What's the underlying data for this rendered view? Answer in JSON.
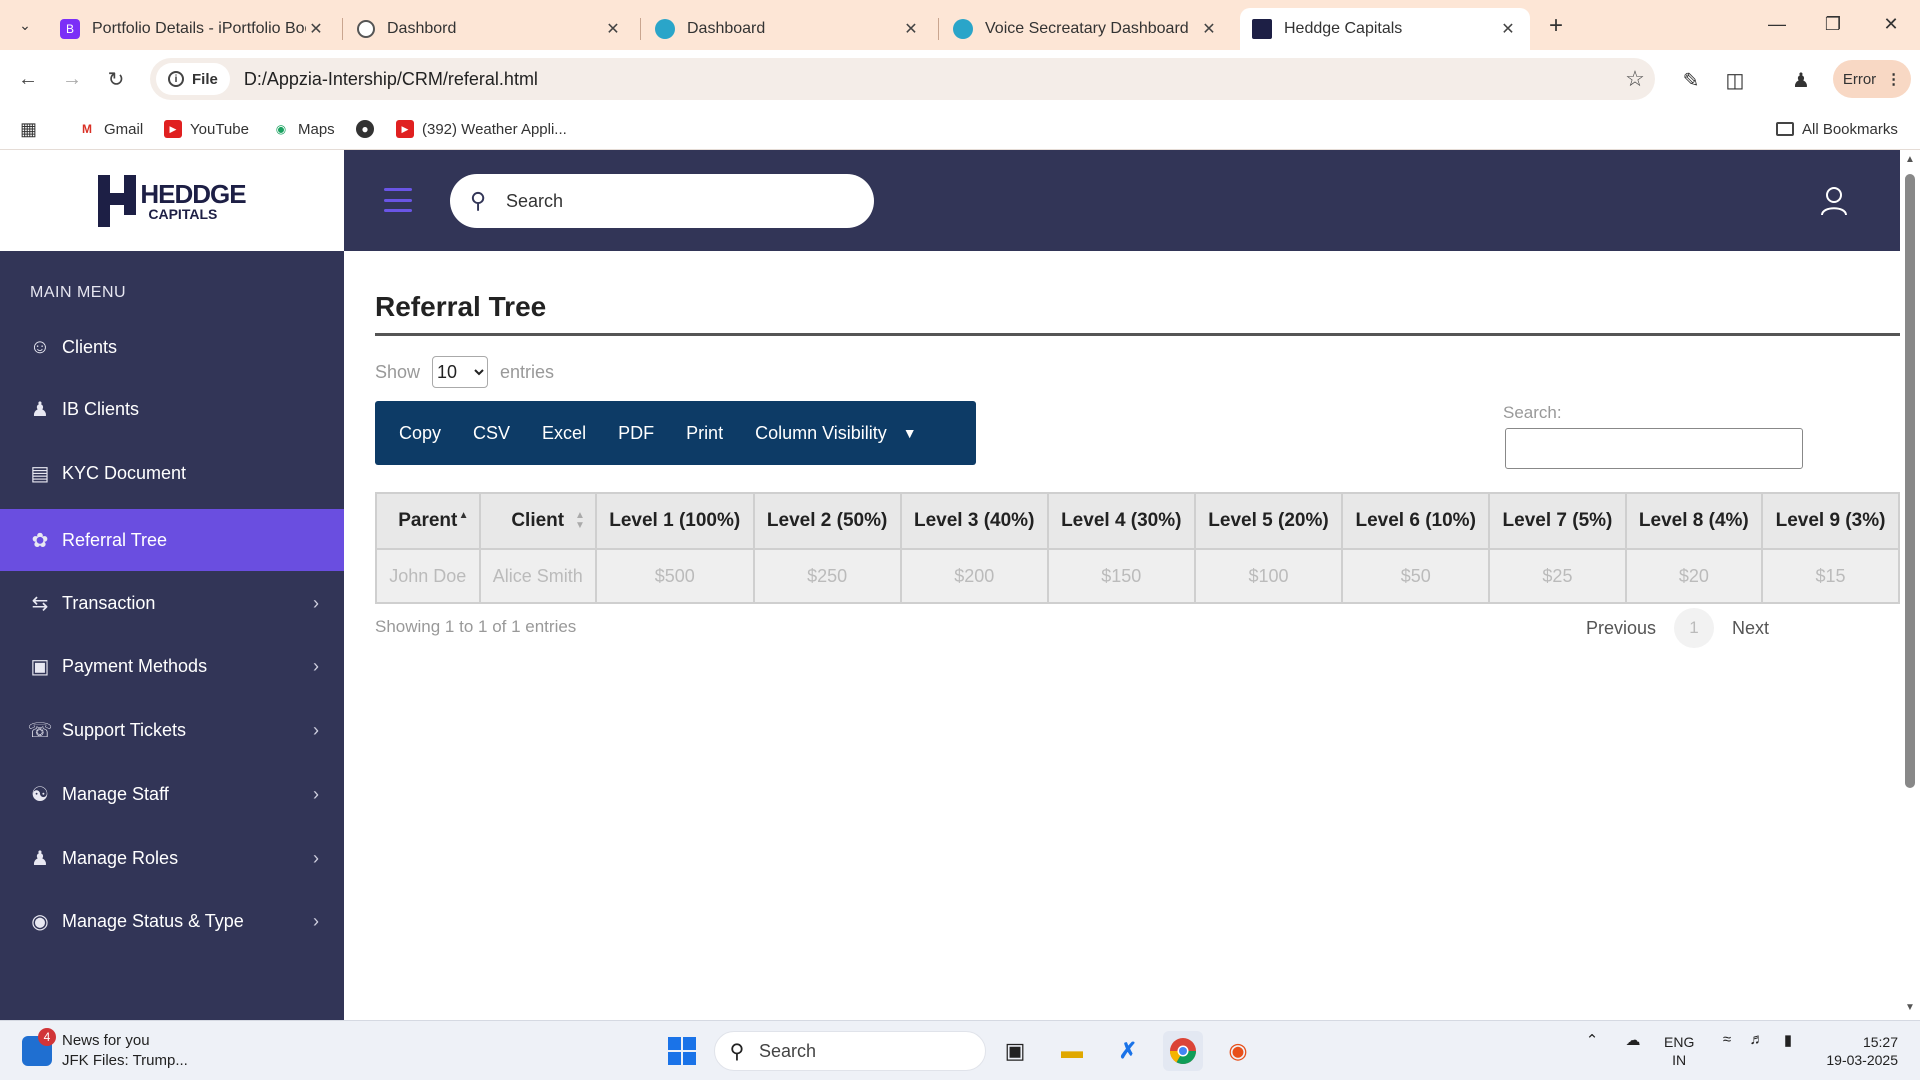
{
  "browser": {
    "tabs": [
      {
        "title": "Portfolio Details - iPortfolio Boo",
        "favicon_letter": "B",
        "favicon_color": "#7b2ff7"
      },
      {
        "title": "Dashbord",
        "favicon_letter": "",
        "favicon_color": "#555555"
      },
      {
        "title": "Dashboard",
        "favicon_letter": "",
        "favicon_color": "#2aa5c9"
      },
      {
        "title": "Voice Secreatary Dashboard",
        "favicon_letter": "",
        "favicon_color": "#2aa5c9"
      },
      {
        "title": "Heddge Capitals",
        "favicon_letter": "",
        "favicon_color": "#1d1f45"
      }
    ],
    "address": {
      "chip_label": "File",
      "url": "D:/Appzia-Intership/CRM/referal.html"
    },
    "profile_button": "Error",
    "bookmarks": [
      {
        "label": "Gmail",
        "icon": "gmail-icon"
      },
      {
        "label": "YouTube",
        "icon": "youtube-icon"
      },
      {
        "label": "Maps",
        "icon": "maps-icon"
      },
      {
        "label": "",
        "icon": "globe-icon"
      },
      {
        "label": "(392) Weather Appli...",
        "icon": "youtube-icon"
      }
    ],
    "all_bookmarks": "All Bookmarks"
  },
  "app": {
    "logo": {
      "line1": "HEDDGE",
      "line2": "CAPITALS"
    },
    "menu_heading": "MAIN MENU",
    "menu": [
      {
        "label": "Clients",
        "icon": "user-icon",
        "chevron": false,
        "active": false
      },
      {
        "label": "IB Clients",
        "icon": "ib-client-icon",
        "chevron": false,
        "active": false
      },
      {
        "label": "KYC Document",
        "icon": "document-icon",
        "chevron": false,
        "active": false
      },
      {
        "label": "Referral Tree",
        "icon": "referral-icon",
        "chevron": false,
        "active": true
      },
      {
        "label": "Transaction",
        "icon": "transaction-icon",
        "chevron": true,
        "active": false
      },
      {
        "label": "Payment Methods",
        "icon": "payment-icon",
        "chevron": true,
        "active": false
      },
      {
        "label": "Support Tickets",
        "icon": "support-icon",
        "chevron": true,
        "active": false
      },
      {
        "label": "Manage Staff",
        "icon": "staff-icon",
        "chevron": true,
        "active": false
      },
      {
        "label": "Manage Roles",
        "icon": "roles-icon",
        "chevron": true,
        "active": false
      },
      {
        "label": "Manage Status & Type",
        "icon": "status-icon",
        "chevron": true,
        "active": false
      }
    ],
    "search_placeholder": "Search",
    "colors": {
      "sidebar": "#323557",
      "active": "#6a4ee0",
      "button_group": "#0d3b66"
    }
  },
  "content": {
    "title": "Referral Tree",
    "show_label": "Show",
    "entries_label": "entries",
    "page_length": "10",
    "buttons": [
      "Copy",
      "CSV",
      "Excel",
      "PDF",
      "Print",
      "Column Visibility"
    ],
    "search_label": "Search:",
    "table": {
      "headers": [
        "Parent",
        "Client",
        "Level 1 (100%)",
        "Level 2 (50%)",
        "Level 3 (40%)",
        "Level 4 (30%)",
        "Level 5 (20%)",
        "Level 6 (10%)",
        "Level 7 (5%)",
        "Level 8 (4%)",
        "Level 9 (3%)"
      ],
      "rows": [
        [
          "John Doe",
          "Alice Smith",
          "$500",
          "$250",
          "$200",
          "$150",
          "$100",
          "$50",
          "$25",
          "$20",
          "$15"
        ]
      ]
    },
    "info": "Showing 1 to 1 of 1 entries",
    "pager": {
      "previous": "Previous",
      "current": "1",
      "next": "Next"
    }
  },
  "taskbar": {
    "news_title": "News for you",
    "news_subtitle": "JFK Files: Trump...",
    "news_badge": "4",
    "search": "Search",
    "lang_line1": "ENG",
    "lang_line2": "IN",
    "time": "15:27",
    "date": "19-03-2025"
  }
}
